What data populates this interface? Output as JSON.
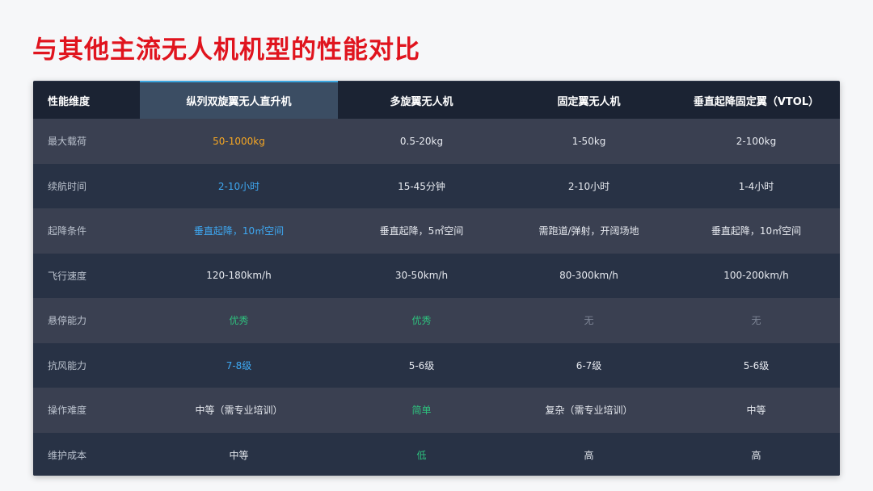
{
  "page": {
    "title": "与其他主流无人机机型的性能对比"
  },
  "table": {
    "headers": [
      "性能维度",
      "纵列双旋翼无人直升机",
      "多旋翼无人机",
      "固定翼无人机",
      "垂直起降固定翼（VTOL）"
    ],
    "rows": [
      [
        "最大载荷",
        "50-1000kg",
        "0.5-20kg",
        "1-50kg",
        "2-100kg"
      ],
      [
        "续航时间",
        "2-10小时",
        "15-45分钟",
        "2-10小时",
        "1-4小时"
      ],
      [
        "起降条件",
        "垂直起降，10㎡空间",
        "垂直起降，5㎡空间",
        "需跑道/弹射，开阔场地",
        "垂直起降，10㎡空间"
      ],
      [
        "飞行速度",
        "120-180km/h",
        "30-50km/h",
        "80-300km/h",
        "100-200km/h"
      ],
      [
        "悬停能力",
        "优秀",
        "优秀",
        "无",
        "无"
      ],
      [
        "抗风能力",
        "7-8级",
        "5-6级",
        "6-7级",
        "5-6级"
      ],
      [
        "操作难度",
        "中等（需专业培训）",
        "简单",
        "复杂（需专业培训）",
        "中等"
      ],
      [
        "维护成本",
        "中等",
        "低",
        "高",
        "高"
      ]
    ]
  },
  "colors": {
    "title": "#e0141e",
    "highlight": "#f5a623",
    "accent_blue": "#3ea8f2",
    "accent_green": "#2ec27e",
    "muted": "#7d8595"
  }
}
